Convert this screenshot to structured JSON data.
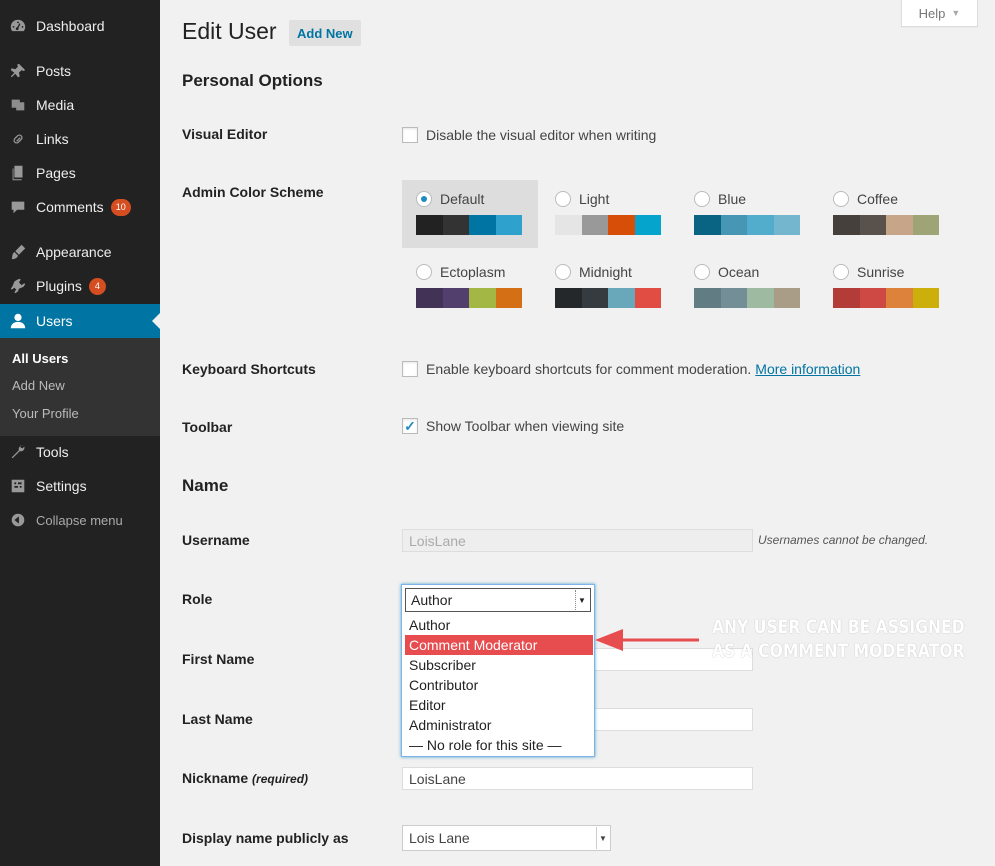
{
  "sidebar": {
    "items": [
      {
        "label": "Dashboard",
        "icon": "dashboard-icon"
      },
      {
        "label": "Posts",
        "icon": "pin-icon"
      },
      {
        "label": "Media",
        "icon": "media-icon"
      },
      {
        "label": "Links",
        "icon": "link-icon"
      },
      {
        "label": "Pages",
        "icon": "pages-icon"
      },
      {
        "label": "Comments",
        "icon": "comment-icon",
        "badge": "10"
      },
      {
        "label": "Appearance",
        "icon": "brush-icon"
      },
      {
        "label": "Plugins",
        "icon": "plugin-icon",
        "badge": "4"
      },
      {
        "label": "Users",
        "icon": "user-icon"
      },
      {
        "label": "Tools",
        "icon": "wrench-icon"
      },
      {
        "label": "Settings",
        "icon": "settings-icon"
      },
      {
        "label": "Collapse menu",
        "icon": "collapse-icon"
      }
    ],
    "submenu": [
      "All Users",
      "Add New",
      "Your Profile"
    ]
  },
  "header": {
    "help": "Help",
    "title": "Edit User",
    "add_new": "Add New"
  },
  "personal": {
    "heading": "Personal Options",
    "visual_editor_label": "Visual Editor",
    "visual_editor_option": "Disable the visual editor when writing",
    "color_scheme_label": "Admin Color Scheme",
    "schemes": [
      {
        "name": "Default",
        "colors": [
          "#222222",
          "#333333",
          "#0074a2",
          "#2ea2cc"
        ]
      },
      {
        "name": "Light",
        "colors": [
          "#e5e5e5",
          "#999999",
          "#d64e07",
          "#04a4cc"
        ]
      },
      {
        "name": "Blue",
        "colors": [
          "#096484",
          "#4796b3",
          "#52accc",
          "#74b6ce"
        ]
      },
      {
        "name": "Coffee",
        "colors": [
          "#46403c",
          "#59524c",
          "#c7a589",
          "#9ea476"
        ]
      },
      {
        "name": "Ectoplasm",
        "colors": [
          "#413256",
          "#523f6d",
          "#a3b745",
          "#d46f15"
        ]
      },
      {
        "name": "Midnight",
        "colors": [
          "#25282b",
          "#363b3f",
          "#69a8bb",
          "#e14d43"
        ]
      },
      {
        "name": "Ocean",
        "colors": [
          "#627c83",
          "#738e96",
          "#9ebaa0",
          "#aa9d88"
        ]
      },
      {
        "name": "Sunrise",
        "colors": [
          "#b43c38",
          "#cf4944",
          "#dd823b",
          "#ccaf0b"
        ]
      }
    ],
    "keyboard_label": "Keyboard Shortcuts",
    "keyboard_option": "Enable keyboard shortcuts for comment moderation.",
    "more_info": "More information",
    "toolbar_label": "Toolbar",
    "toolbar_option": "Show Toolbar when viewing site"
  },
  "name": {
    "heading": "Name",
    "username_label": "Username",
    "username_value": "LoisLane",
    "username_note": "Usernames cannot be changed.",
    "role_label": "Role",
    "role_value": "Author",
    "role_options": [
      "Author",
      "Comment Moderator",
      "Subscriber",
      "Contributor",
      "Editor",
      "Administrator",
      "— No role for this site —"
    ],
    "first_name_label": "First Name",
    "last_name_label": "Last Name",
    "nickname_label": "Nickname",
    "nickname_required": "(required)",
    "nickname_value": "LoisLane",
    "display_label": "Display name publicly as",
    "display_value": "Lois Lane"
  },
  "annotation": {
    "line1": "ANY USER CAN BE ASSIGNED",
    "line2": "AS A COMMENT MODERATOR",
    "arrow_color": "#e74c4f"
  }
}
